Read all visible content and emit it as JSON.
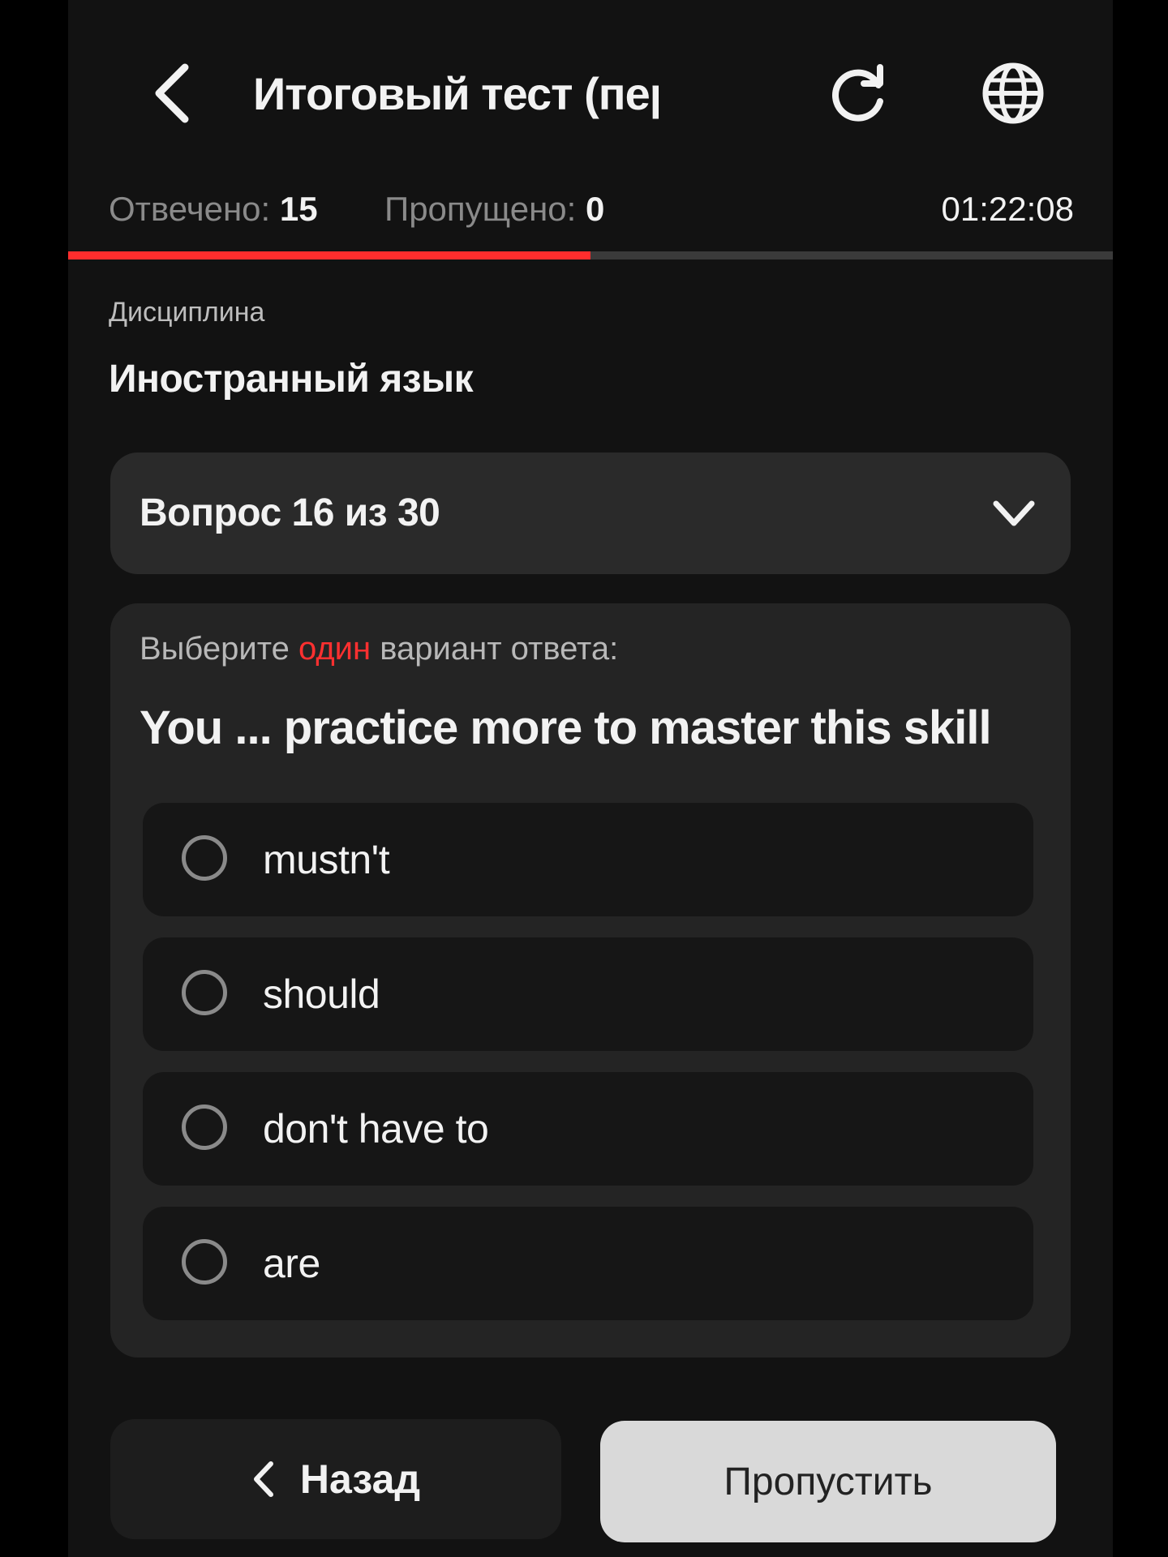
{
  "header": {
    "title": "Итоговый тест (пер...",
    "back_icon": "chevron-left-icon",
    "reload_icon": "reload-icon",
    "language_icon": "globe-icon"
  },
  "stats": {
    "answered_label": "Отвечено:",
    "answered_value": "15",
    "skipped_label": "Пропущено:",
    "skipped_value": "0",
    "timer": "01:22:08"
  },
  "progress": {
    "fraction": 0.5,
    "fill_color": "#ff2d2d"
  },
  "discipline": {
    "label": "Дисциплина",
    "value": "Иностранный язык"
  },
  "question_selector": {
    "label": "Вопрос 16 из 30",
    "icon": "chevron-down-icon"
  },
  "question": {
    "instruction_prefix": "Выберите",
    "instruction_accent": "один",
    "instruction_suffix": "вариант ответа:",
    "text": "You ... practice more to master this skill",
    "options": [
      {
        "label": "mustn't"
      },
      {
        "label": "should"
      },
      {
        "label": "don't have to"
      },
      {
        "label": "are"
      }
    ]
  },
  "footer": {
    "back_label": "Назад",
    "skip_label": "Пропустить"
  },
  "colors": {
    "accent": "#ff2d2d",
    "background": "#121212"
  }
}
